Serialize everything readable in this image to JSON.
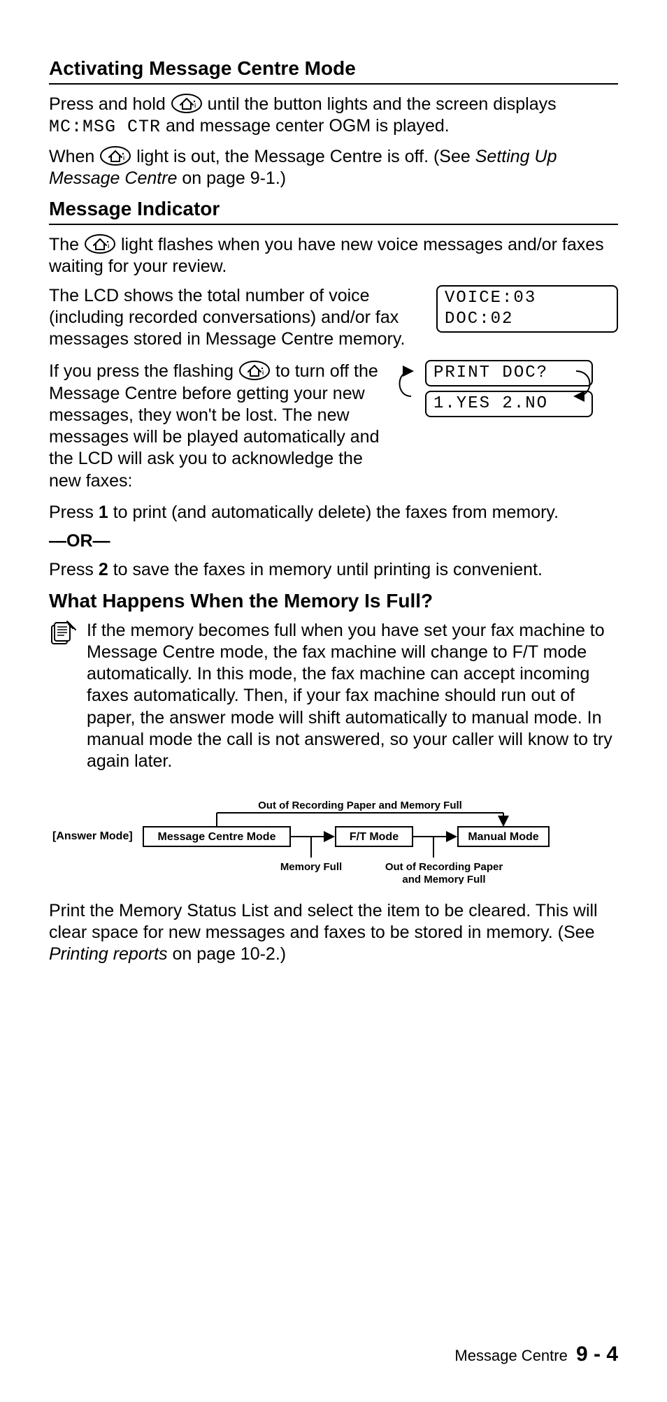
{
  "sections": {
    "activating": {
      "heading": "Activating Message Centre Mode",
      "p1a": "Press and hold ",
      "p1b": " until the button lights and the screen displays ",
      "p1_code": "MC:MSG CTR",
      "p1c": " and message center OGM is played.",
      "p2a": "When ",
      "p2b": " light is out, the Message Centre is off. (See ",
      "p2_ref": "Setting Up Message Centre",
      "p2c": " on page 9-1.)"
    },
    "indicator": {
      "heading": "Message Indicator",
      "p1a": "The ",
      "p1b": " light flashes when you have new voice messages and/or faxes waiting for your review.",
      "p2": "The LCD shows the total number of voice (including recorded conversations) and/or fax messages stored in Message Centre memory.",
      "lcd1": "VOICE:03 DOC:02",
      "p3a": "If you press the flashing ",
      "p3b": " to turn off the Message Centre before getting your new messages, they won't be lost. The new messages will be played automatically and the LCD will ask you to acknowledge the new faxes:",
      "lcd2": "PRINT DOC?",
      "lcd3": "1.YES 2.NO",
      "p4a": "Press ",
      "p4_key1": "1",
      "p4b": " to print (and automatically delete) the faxes from memory.",
      "or": "—OR—",
      "p5a": "Press ",
      "p5_key2": "2",
      "p5b": " to save the faxes in memory until printing is convenient."
    },
    "memoryfull": {
      "heading": "What Happens When the Memory Is Full?",
      "note": "If the memory becomes full when you have set your fax machine to Message Centre mode, the fax machine will change to F/T mode automatically. In this mode, the fax machine can accept incoming faxes automatically. Then, if your fax machine should run out of paper, the answer mode will shift automatically to manual mode. In manual mode the call is not answered, so your caller will know to try again later.",
      "diagram": {
        "answer_mode": "[Answer Mode]",
        "box1": "Message Centre Mode",
        "box2": "F/T Mode",
        "box3": "Manual Mode",
        "top_label": "Out of Recording Paper and Memory Full",
        "mid_label": "Memory Full",
        "right_label_l1": "Out of Recording Paper",
        "right_label_l2": "and Memory Full"
      },
      "p_after_a": "Print the Memory Status List and select the item to be cleared. This will clear space for new messages and faxes to be stored in memory. (See ",
      "p_after_ref": "Printing reports",
      "p_after_b": " on page 10-2.)"
    }
  },
  "footer": {
    "chapter": "Message Centre",
    "page": "9 - 4"
  }
}
